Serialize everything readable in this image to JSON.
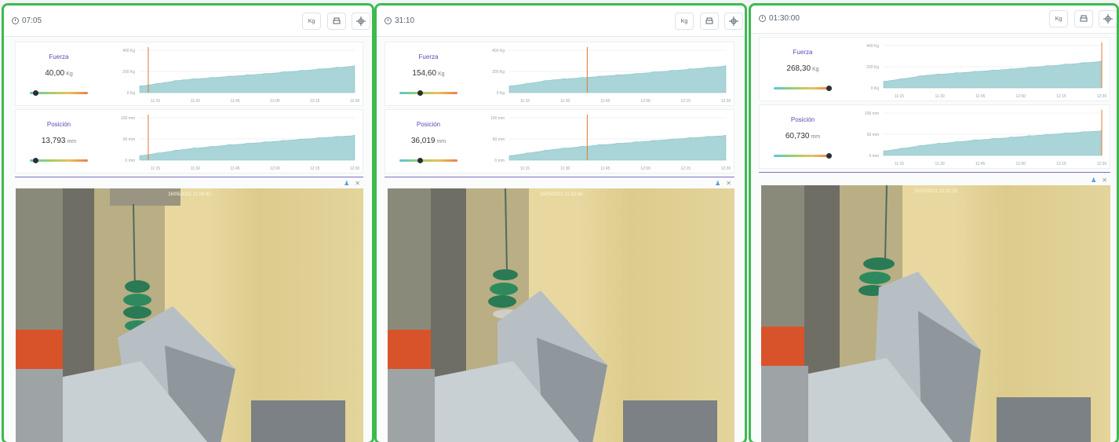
{
  "panels": [
    {
      "timer": "07:05",
      "toolbar": {
        "unit_label": "Kg"
      },
      "force": {
        "title": "Fuerza",
        "value": "40,00",
        "unit": "Kg",
        "level": 0.1
      },
      "position": {
        "title": "Posición",
        "value": "13,793",
        "unit": "mm",
        "level": 0.1
      },
      "force_chart": {
        "y_ticks": [
          "400 Kg",
          "200 Kg",
          "0 Kg"
        ],
        "x_ticks": [
          "11:15",
          "11:30",
          "11:45",
          "12:00",
          "12:15",
          "12:30"
        ],
        "marker": 0.04
      },
      "position_chart": {
        "y_ticks": [
          "100 mm",
          "50 mm",
          "0 mm"
        ],
        "x_ticks": [
          "11:15",
          "11:30",
          "11:45",
          "12:00",
          "12:15",
          "12:30"
        ],
        "marker": 0.04
      },
      "camera": {
        "timestamp": "16/05/2021  11:08:40"
      }
    },
    {
      "timer": "31:10",
      "toolbar": {
        "unit_label": "Kg"
      },
      "force": {
        "title": "Fuerza",
        "value": "154,60",
        "unit": "Kg",
        "level": 0.36
      },
      "position": {
        "title": "Posición",
        "value": "36,019",
        "unit": "mm",
        "level": 0.36
      },
      "force_chart": {
        "y_ticks": [
          "400 Kg",
          "200 Kg",
          "0 Kg"
        ],
        "x_ticks": [
          "11:15",
          "11:30",
          "11:45",
          "12:00",
          "12:15",
          "12:30"
        ],
        "marker": 0.36
      },
      "position_chart": {
        "y_ticks": [
          "100 mm",
          "50 mm",
          "0 mm"
        ],
        "x_ticks": [
          "11:15",
          "11:30",
          "11:45",
          "12:00",
          "12:15",
          "12:30"
        ],
        "marker": 0.36
      },
      "camera": {
        "timestamp": "16/05/2021  11:32:36"
      }
    },
    {
      "timer": "01:30:00",
      "toolbar": {
        "unit_label": "Kg"
      },
      "force": {
        "title": "Fuerza",
        "value": "268,30",
        "unit": "Kg",
        "level": 0.95
      },
      "position": {
        "title": "Posición",
        "value": "60,730",
        "unit": "mm",
        "level": 0.95
      },
      "force_chart": {
        "y_ticks": [
          "400 Kg",
          "200 Kg",
          "0 Kg"
        ],
        "x_ticks": [
          "11:15",
          "11:30",
          "11:45",
          "12:00",
          "12:15",
          "12:30"
        ],
        "marker": 1.0
      },
      "position_chart": {
        "y_ticks": [
          "100 mm",
          "50 mm",
          "0 mm"
        ],
        "x_ticks": [
          "11:15",
          "11:30",
          "11:45",
          "12:00",
          "12:15",
          "12:30"
        ],
        "marker": 1.0
      },
      "camera": {
        "timestamp": "16/05/2021  12:31:25"
      }
    }
  ],
  "icons": [
    "clock-icon",
    "print-icon",
    "crosshair-icon",
    "user-icon",
    "close-icon"
  ],
  "colors": {
    "panel_border": "#3dba4f",
    "chart_fill": "#a9d4d8",
    "marker": "#e07a2e",
    "title": "#5b49b5"
  },
  "chart_data": [
    {
      "type": "area",
      "title": "",
      "xlabel": "",
      "ylabel": "",
      "ylim": [
        0,
        400
      ],
      "x": [
        "11:15",
        "11:30",
        "11:45",
        "12:00",
        "12:15",
        "12:30"
      ],
      "series": [
        {
          "values": [
            60,
            120,
            150,
            180,
            215,
            250
          ]
        }
      ]
    },
    {
      "type": "area",
      "title": "",
      "xlabel": "",
      "ylabel": "",
      "ylim": [
        0,
        100
      ],
      "x": [
        "11:15",
        "11:30",
        "11:45",
        "12:00",
        "12:15",
        "12:30"
      ],
      "series": [
        {
          "values": [
            10,
            25,
            35,
            43,
            51,
            58
          ]
        }
      ]
    }
  ]
}
